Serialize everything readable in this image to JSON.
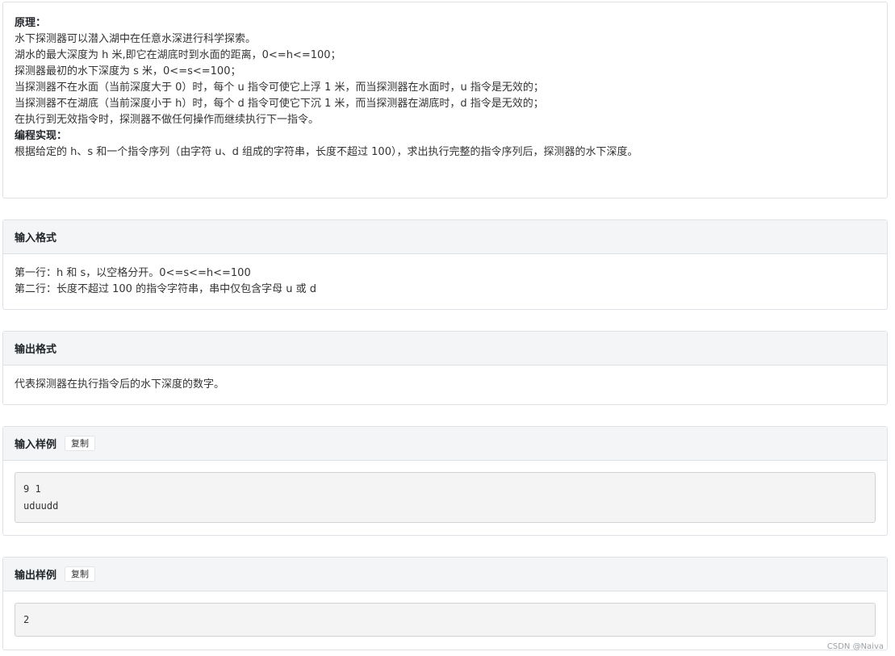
{
  "description": {
    "principle_title": "原理：",
    "lines": [
      "水下探测器可以潜入湖中在任意水深进行科学探索。",
      "湖水的最大深度为 h 米,即它在湖底时到水面的距离，0<=h<=100；",
      "探测器最初的水下深度为 s 米，0<=s<=100；",
      "当探测器不在水面（当前深度大于 0）时，每个 u 指令可使它上浮 1 米，而当探测器在水面时，u 指令是无效的；",
      "当探测器不在湖底（当前深度小于 h）时，每个 d 指令可使它下沉 1 米，而当探测器在湖底时，d 指令是无效的；",
      "在执行到无效指令时，探测器不做任何操作而继续执行下一指令。"
    ],
    "impl_title": "编程实现：",
    "impl_line": "根据给定的 h、s 和一个指令序列（由字符 u、d 组成的字符串，长度不超过 100），求出执行完整的指令序列后，探测器的水下深度。"
  },
  "input_format": {
    "title": "输入格式",
    "lines": [
      "第一行：h 和 s，以空格分开。0<=s<=h<=100",
      "第二行：长度不超过 100 的指令字符串，串中仅包含字母 u 或 d"
    ]
  },
  "output_format": {
    "title": "输出格式",
    "line": "代表探测器在执行指令后的水下深度的数字。"
  },
  "input_sample": {
    "title": "输入样例",
    "copy_label": "复制",
    "lines": [
      "9 1",
      "uduudd"
    ]
  },
  "output_sample": {
    "title": "输出样例",
    "copy_label": "复制",
    "lines": [
      "2"
    ]
  },
  "watermark": "CSDN @Naiva"
}
